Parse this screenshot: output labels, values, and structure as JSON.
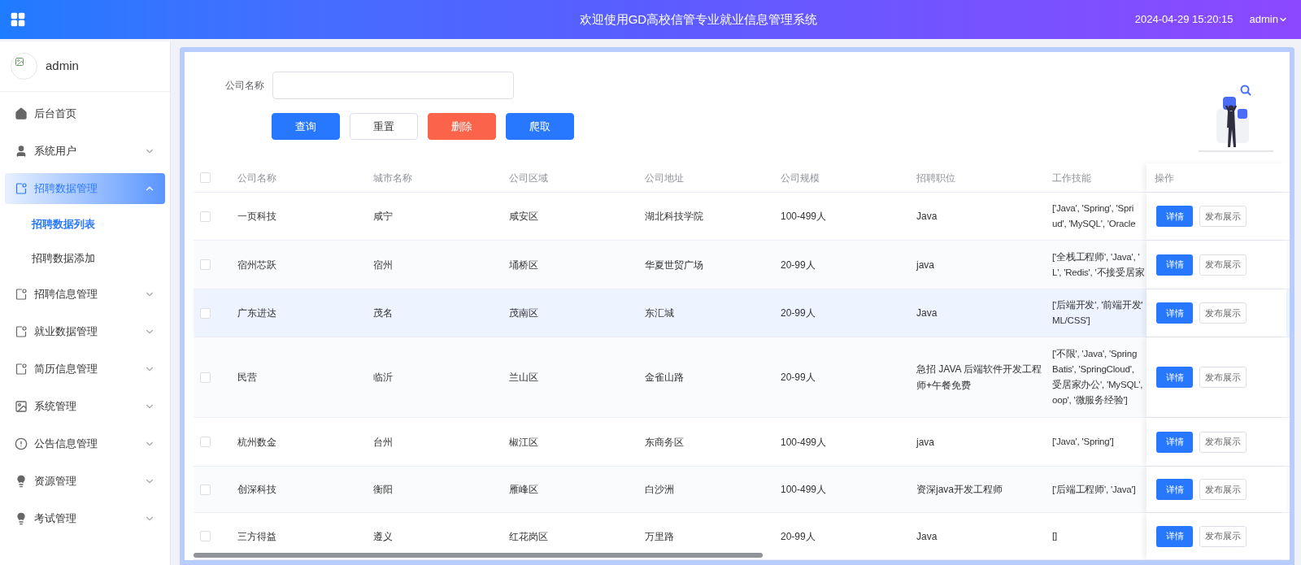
{
  "header": {
    "title": "欢迎使用GD高校信管专业就业信息管理系统",
    "datetime": "2024-04-29 15:20:15",
    "user": "admin"
  },
  "sidebar": {
    "username": "admin",
    "items": [
      {
        "label": "后台首页",
        "kind": "home",
        "selected": false
      },
      {
        "label": "系统用户",
        "kind": "user",
        "selected": false,
        "expanded": false
      },
      {
        "label": "招聘数据管理",
        "kind": "document",
        "selected": true,
        "expanded": true,
        "children": [
          {
            "label": "招聘数据列表",
            "selected": true
          },
          {
            "label": "招聘数据添加",
            "selected": false
          }
        ]
      },
      {
        "label": "招聘信息管理",
        "kind": "document",
        "selected": false,
        "expanded": false
      },
      {
        "label": "就业数据管理",
        "kind": "document",
        "selected": false,
        "expanded": false
      },
      {
        "label": "简历信息管理",
        "kind": "document",
        "selected": false,
        "expanded": false
      },
      {
        "label": "系统管理",
        "kind": "image",
        "selected": false,
        "expanded": false
      },
      {
        "label": "公告信息管理",
        "kind": "notice",
        "selected": false,
        "expanded": false
      },
      {
        "label": "资源管理",
        "kind": "bulb",
        "selected": false,
        "expanded": false
      },
      {
        "label": "考试管理",
        "kind": "bulb",
        "selected": false,
        "expanded": false
      }
    ]
  },
  "search": {
    "label": "公司名称",
    "buttons": [
      {
        "label": "查询",
        "kind": "primary"
      },
      {
        "label": "重置",
        "kind": "plain"
      },
      {
        "label": "删除",
        "kind": "danger"
      },
      {
        "label": "爬取",
        "kind": "primary"
      }
    ]
  },
  "table": {
    "select_all_checked": false,
    "columns": [
      "公司名称",
      "城市名称",
      "公司区域",
      "公司地址",
      "公司规模",
      "招聘职位",
      "工作技能",
      "操作"
    ],
    "rows": [
      {
        "checked": false,
        "highlighted": false,
        "cells": [
          "一页科技",
          "咸宁",
          "咸安区",
          "湖北科技学院",
          "100-499人",
          "Java"
        ],
        "skills": [
          "['Java', 'Spring', 'Spri",
          "ud', 'MySQL', 'Oracle"
        ],
        "actions": [
          "详情",
          "发布展示"
        ]
      },
      {
        "checked": false,
        "highlighted": false,
        "cells": [
          "宿州芯跃",
          "宿州",
          "埇桥区",
          "华夏世贸广场",
          "20-99人",
          "java"
        ],
        "skills": [
          "['全栈工程师', 'Java', '",
          "L', 'Redis', '不接受居家"
        ],
        "actions": [
          "详情",
          "发布展示"
        ]
      },
      {
        "checked": false,
        "highlighted": true,
        "cells": [
          "广东进达",
          "茂名",
          "茂南区",
          "东汇城",
          "20-99人",
          "Java"
        ],
        "skills": [
          "['后端开发', '前端开发'",
          "ML/CSS']"
        ],
        "actions": [
          "详情",
          "发布展示"
        ]
      },
      {
        "checked": false,
        "highlighted": false,
        "cells": [
          "民营",
          "临沂",
          "兰山区",
          "金雀山路",
          "20-99人",
          "急招 JAVA 后端软件开发工程师+午餐免费"
        ],
        "skills": [
          "['不限', 'Java', 'Spring",
          "Batis', 'SpringCloud',",
          "受居家办公', 'MySQL',",
          "oop', '微服务经验']"
        ],
        "actions": [
          "详情",
          "发布展示"
        ]
      },
      {
        "checked": false,
        "highlighted": false,
        "cells": [
          "杭州数金",
          "台州",
          "椒江区",
          "东商务区",
          "100-499人",
          "java"
        ],
        "skills": [
          "['Java', 'Spring']"
        ],
        "actions": [
          "详情",
          "发布展示"
        ]
      },
      {
        "checked": false,
        "highlighted": false,
        "cells": [
          "创深科技",
          "衡阳",
          "雁峰区",
          "白沙洲",
          "100-499人",
          "资深java开发工程师"
        ],
        "skills": [
          "['后端工程师', 'Java']"
        ],
        "actions": [
          "详情",
          "发布展示"
        ]
      },
      {
        "checked": false,
        "highlighted": false,
        "cells": [
          "三方得益",
          "遵义",
          "红花岗区",
          "万里路",
          "20-99人",
          "Java"
        ],
        "skills": [
          "[]"
        ],
        "actions": [
          "详情",
          "发布展示"
        ]
      }
    ]
  }
}
